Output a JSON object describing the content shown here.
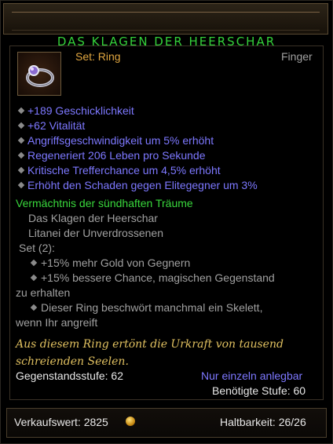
{
  "item": {
    "name": "DAS KLAGEN DER HEERSCHAR",
    "type_label": "Set: Ring",
    "slot": "Finger",
    "icon": "ring-icon"
  },
  "stats": [
    "+189 Geschicklichkeit",
    "+62 Vitalität",
    "Angriffsgeschwindigkeit um 5% erhöht",
    "Regeneriert 206 Leben pro Sekunde",
    "Kritische Trefferchance um 4,5% erhöht",
    "Erhöht den Schaden gegen Elitegegner um 3%"
  ],
  "set": {
    "name": "Vermächtnis der sündhaften Träume",
    "pieces": [
      "Das Klagen der Heerschar",
      "Litanei der Unverdrossenen"
    ],
    "bonus_header": "Set (2):",
    "bonuses": [
      "+15% mehr Gold von Gegnern",
      "+15% bessere Chance, magischen Gegenstand",
      "zu erhalten",
      "Dieser Ring beschwört manchmal ein Skelett,",
      "wenn Ihr angreift"
    ]
  },
  "flavor": [
    "Aus diesem Ring ertönt die Urkraft von tausend",
    "schreienden Seelen."
  ],
  "item_level": "Gegenstandsstufe: 62",
  "unique_equipped": "Nur einzeln anlegbar",
  "required_level": "Benötigte Stufe: 60",
  "sell_value": "Verkaufswert: 2825",
  "durability": "Haltbarkeit: 26/26",
  "colors": {
    "title_green": "#34d13a",
    "magic_blue": "#7d78ff",
    "flavor_gold": "#e0c060",
    "type_orange": "#e0a640"
  }
}
